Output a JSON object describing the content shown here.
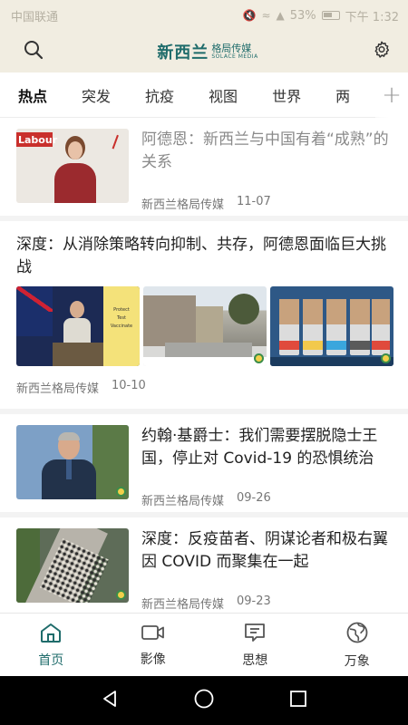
{
  "status_bar": {
    "carrier": "中国联通",
    "battery": "53%",
    "time": "下午 1:32"
  },
  "app": {
    "logo_main": "新西兰",
    "logo_cn": "格局传媒",
    "logo_en": "SOLACE MEDIA"
  },
  "tabs": [
    {
      "label": "热点",
      "active": true
    },
    {
      "label": "突发"
    },
    {
      "label": "抗疫"
    },
    {
      "label": "视图"
    },
    {
      "label": "世界"
    },
    {
      "label": "两"
    }
  ],
  "tab_add": "+",
  "articles": [
    {
      "title": "阿德恩：新西兰与中国有着“成熟”的关系",
      "source": "新西兰格局传媒",
      "date": "11-07",
      "read": true,
      "thumb_text": "Labour"
    },
    {
      "title": "深度：从消除策略转向抑制、共存，阿德恩面临巨大挑战",
      "source": "新西兰格局传媒",
      "date": "10-10",
      "board_text": [
        "Protect",
        "Test",
        "Vaccinate"
      ]
    },
    {
      "title": "约翰·基爵士：我们需要摆脱隐士王国，停止对 Covid-19 的恐惧统治",
      "source": "新西兰格局传媒",
      "date": "09-26"
    },
    {
      "title": "深度：反疫苗者、阴谋论者和极右翼因 COVID 而聚集在一起",
      "source": "新西兰格局传媒",
      "date": "09-23"
    }
  ],
  "bottom_nav": [
    {
      "label": "首页",
      "icon": "home-icon",
      "active": true
    },
    {
      "label": "影像",
      "icon": "video-icon"
    },
    {
      "label": "思想",
      "icon": "thought-icon"
    },
    {
      "label": "万象",
      "icon": "globe-icon"
    }
  ],
  "colors": {
    "accent": "#1f6c6b",
    "header_bg": "#f1ede1"
  }
}
